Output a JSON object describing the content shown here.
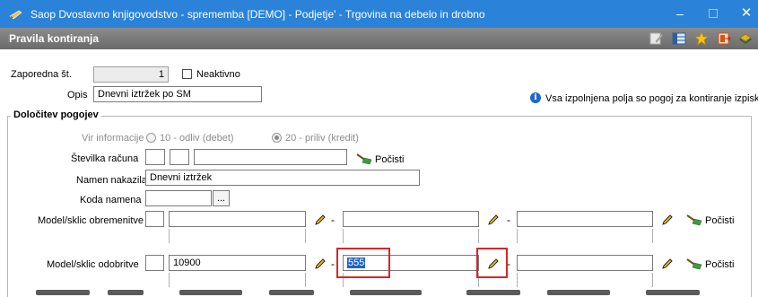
{
  "window": {
    "title": "Saop Dvostavno knjigovodstvo - sprememba [DEMO] - Podjetje' - Trgovina na debelo in drobno",
    "minimize": "–",
    "close": "✕"
  },
  "toolbar": {
    "heading": "Pravila kontiranja",
    "icons": [
      "edit-icon",
      "grid-icon",
      "star-icon",
      "exit-icon",
      "books-icon"
    ]
  },
  "form": {
    "zaporedna_label": "Zaporedna št.",
    "zaporedna_value": "1",
    "neaktivno_label": "Neaktivno",
    "opis_label": "Opis",
    "opis_value": "Dnevni iztržek po SM",
    "info_text": "Vsa izpolnjena polja so pogoj za kontiranje izpiska."
  },
  "conditions": {
    "group_title": "Določitev pogojev",
    "vir_label": "Vir informacije",
    "vir_option1": "10 - odliv (debet)",
    "vir_option2": "20 - priliv (kredit)",
    "vir_selected": "20 - priliv (kredit)",
    "stevilka_label": "Številka računa",
    "stevilka_part1": "",
    "stevilka_part2": "",
    "stevilka_part3": "",
    "clear_label": "Počisti",
    "namen_label": "Namen nakazila",
    "namen_value": "Dnevni iztržek",
    "koda_label": "Koda namena",
    "koda_value": "",
    "koda_button": "...",
    "model_obr_label": "Model/sklic obremenitve",
    "model_obr_model": "",
    "model_obr_ref1": "",
    "model_obr_ref2": "",
    "model_obr_ref3": "",
    "model_odb_label": "Model/sklic odobritve",
    "model_odb_model": "",
    "model_odb_ref1": "10900",
    "model_odb_ref2": "555",
    "model_odb_ref3": "",
    "dash": "-"
  },
  "colors": {
    "title_bar": "#2b82d9",
    "toolbar": "#7b7b7b",
    "highlight": "#d8262a",
    "selection": "#1e64c8"
  }
}
